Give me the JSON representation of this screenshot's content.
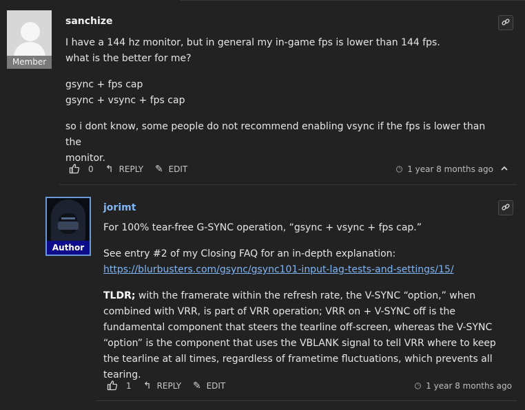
{
  "comments": [
    {
      "username": "sanchize",
      "role_badge": "Member",
      "paragraphs": [
        [
          "I have a 144 hz monitor, but in general my in-game fps is lower than 144 fps.",
          "what is the better for me?"
        ],
        [
          "gsync + fps cap",
          "gsync + vsync + fps cap"
        ],
        [
          "so i dont know, some people do not recommend enabling vsync if the fps is lower than the",
          "monitor."
        ]
      ],
      "votes": "0",
      "reply_label": "REPLY",
      "edit_label": "EDIT",
      "timestamp": "1 year 8 months ago"
    },
    {
      "username": "jorimt",
      "role_badge": "Author",
      "line1": "For 100% tear-free G-SYNC operation, “gsync + vsync + fps cap.”",
      "line2": "See entry #2 of my Closing FAQ for an in-depth explanation:",
      "link": "https://blurbusters.com/gsync/gsync101-input-lag-tests-and-settings/15/",
      "tldr_label": "TLDR;",
      "tldr_text": " with the framerate within the refresh rate, the V-SYNC “option,” when combined with VRR, is part of VRR operation; VRR on + V-SYNC off is the fundamental component that steers the tearline off-screen, whereas the V-SYNC “option” is the component that uses the VBLANK signal to tell VRR where to keep the tearline at all times, regardless of frametime fluctuations, which prevents all tearing.",
      "votes": "1",
      "reply_label": "REPLY",
      "edit_label": "EDIT",
      "timestamp": "1 year 8 months ago"
    }
  ],
  "icons": {
    "thumb": "thumbs-up-icon",
    "reply": "reply-arrow-icon",
    "edit": "pencil-icon",
    "clock": "clock-icon",
    "link": "link-icon",
    "collapse": "chevron-up-icon"
  },
  "colors": {
    "background": "#222223",
    "username_author": "#7fb6f5",
    "author_badge": "#0d0d8c",
    "member_badge": "#7a7a7a"
  }
}
